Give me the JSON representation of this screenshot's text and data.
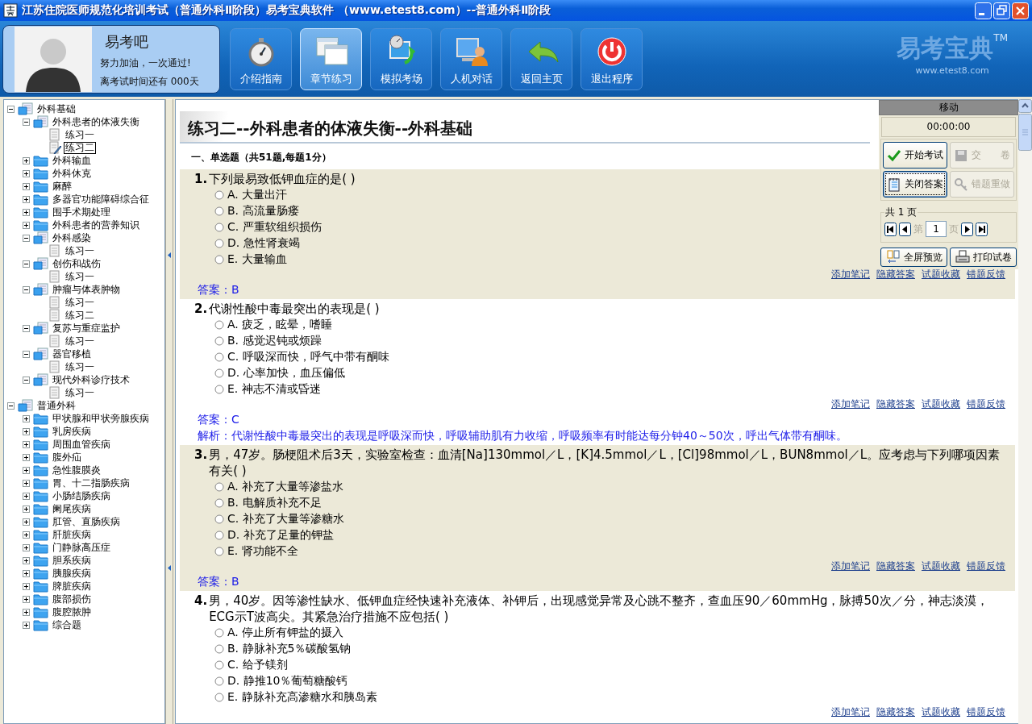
{
  "window": {
    "title": "江苏住院医师规范化培训考试（普通外科Ⅱ阶段）易考宝典软件  （www.etest8.com）--普通外科Ⅱ阶段"
  },
  "profile": {
    "name": "易考吧",
    "slogan": "努力加油，一次通过!",
    "countdown": "离考试时间还有 000天"
  },
  "toolbar": [
    {
      "label": "介绍指南",
      "selected": false
    },
    {
      "label": "章节练习",
      "selected": true
    },
    {
      "label": "模拟考场",
      "selected": false
    },
    {
      "label": "人机对话",
      "selected": false
    },
    {
      "label": "返回主页",
      "selected": false
    },
    {
      "label": "退出程序",
      "selected": false
    }
  ],
  "logo": {
    "name": "易考宝典",
    "mark": "TM",
    "url": "www.etest8.com"
  },
  "tree": [
    {
      "label": "外科基础",
      "kind": "folder",
      "expanded": true,
      "children": [
        {
          "label": "外科患者的体液失衡",
          "kind": "folder",
          "expanded": true,
          "children": [
            {
              "label": "练习一",
              "kind": "exercise",
              "selected": false
            },
            {
              "label": "练习二",
              "kind": "exercise",
              "selected": true
            }
          ]
        },
        {
          "label": "外科输血",
          "kind": "folder",
          "expanded": false
        },
        {
          "label": "外科休克",
          "kind": "folder",
          "expanded": false
        },
        {
          "label": "麻醉",
          "kind": "folder",
          "expanded": false
        },
        {
          "label": "多器官功能障碍综合征",
          "kind": "folder",
          "expanded": false
        },
        {
          "label": "围手术期处理",
          "kind": "folder",
          "expanded": false
        },
        {
          "label": "外科患者的营养知识",
          "kind": "folder",
          "expanded": false
        },
        {
          "label": "外科感染",
          "kind": "folder",
          "expanded": true,
          "children": [
            {
              "label": "练习一",
              "kind": "exercise",
              "selected": false
            }
          ]
        },
        {
          "label": "创伤和战伤",
          "kind": "folder",
          "expanded": true,
          "children": [
            {
              "label": "练习一",
              "kind": "exercise",
              "selected": false
            }
          ]
        },
        {
          "label": "肿瘤与体表肿物",
          "kind": "folder",
          "expanded": true,
          "children": [
            {
              "label": "练习一",
              "kind": "exercise",
              "selected": false
            },
            {
              "label": "练习二",
              "kind": "exercise",
              "selected": false
            }
          ]
        },
        {
          "label": "复苏与重症监护",
          "kind": "folder",
          "expanded": true,
          "children": [
            {
              "label": "练习一",
              "kind": "exercise",
              "selected": false
            }
          ]
        },
        {
          "label": "器官移植",
          "kind": "folder",
          "expanded": true,
          "children": [
            {
              "label": "练习一",
              "kind": "exercise",
              "selected": false
            }
          ]
        },
        {
          "label": "现代外科诊疗技术",
          "kind": "folder",
          "expanded": true,
          "children": [
            {
              "label": "练习一",
              "kind": "exercise",
              "selected": false
            }
          ]
        }
      ]
    },
    {
      "label": "普通外科",
      "kind": "folder",
      "expanded": true,
      "children": [
        {
          "label": "甲状腺和甲状旁腺疾病",
          "kind": "folder",
          "expanded": false
        },
        {
          "label": "乳房疾病",
          "kind": "folder",
          "expanded": false
        },
        {
          "label": "周围血管疾病",
          "kind": "folder",
          "expanded": false
        },
        {
          "label": "腹外疝",
          "kind": "folder",
          "expanded": false
        },
        {
          "label": "急性腹膜炎",
          "kind": "folder",
          "expanded": false
        },
        {
          "label": "胃、十二指肠疾病",
          "kind": "folder",
          "expanded": false
        },
        {
          "label": "小肠结肠疾病",
          "kind": "folder",
          "expanded": false
        },
        {
          "label": "阑尾疾病",
          "kind": "folder",
          "expanded": false
        },
        {
          "label": "肛管、直肠疾病",
          "kind": "folder",
          "expanded": false
        },
        {
          "label": "肝脏疾病",
          "kind": "folder",
          "expanded": false
        },
        {
          "label": "门静脉高压症",
          "kind": "folder",
          "expanded": false
        },
        {
          "label": "胆系疾病",
          "kind": "folder",
          "expanded": false
        },
        {
          "label": "胰腺疾病",
          "kind": "folder",
          "expanded": false
        },
        {
          "label": "脾脏疾病",
          "kind": "folder",
          "expanded": false
        },
        {
          "label": "腹部损伤",
          "kind": "folder",
          "expanded": false
        },
        {
          "label": "腹腔脓肿",
          "kind": "folder",
          "expanded": false
        },
        {
          "label": "综合题",
          "kind": "folder",
          "expanded": false
        }
      ]
    }
  ],
  "content": {
    "title": "练习二--外科患者的体液失衡--外科基础",
    "section": "一、单选题（共51题,每题1分）",
    "questions": [
      {
        "number": "1.",
        "text": "下列最易致低钾血症的是( )",
        "highlighted": true,
        "options": [
          {
            "text": "A. 大量出汗",
            "selected": false
          },
          {
            "text": "B. 高流量肠瘘",
            "selected": false
          },
          {
            "text": "C. 严重软组织损伤",
            "selected": false
          },
          {
            "text": "D. 急性肾衰竭",
            "selected": false
          },
          {
            "text": "E. 大量输血",
            "selected": false
          }
        ],
        "links": [
          "添加笔记",
          "隐藏答案",
          "试题收藏",
          "错题反馈"
        ],
        "answer": "答案：B"
      },
      {
        "number": "2.",
        "text": "代谢性酸中毒最突出的表现是( )",
        "highlighted": false,
        "options": [
          {
            "text": "A. 疲乏，眩晕，嗜睡",
            "selected": false
          },
          {
            "text": "B. 感觉迟钝或烦躁",
            "selected": false
          },
          {
            "text": "C. 呼吸深而快，呼气中带有酮味",
            "selected": false
          },
          {
            "text": "D. 心率加快，血压偏低",
            "selected": false
          },
          {
            "text": "E. 神志不清或昏迷",
            "selected": false
          }
        ],
        "links": [
          "添加笔记",
          "隐藏答案",
          "试题收藏",
          "错题反馈"
        ],
        "answer": "答案：C",
        "explanation": "解析：代谢性酸中毒最突出的表现是呼吸深而快，呼吸辅助肌有力收缩，呼吸频率有时能达每分钟40～50次，呼出气体带有酮味。"
      },
      {
        "number": "3.",
        "text": "男，47岁。肠梗阻术后3天，实验室检查：血清[Na]130mmol／L，[K]4.5mmol／L，[Cl]98mmol／L，BUN8mmol／L。应考虑与下列哪项因素有关( )",
        "highlighted": true,
        "options": [
          {
            "text": "A. 补充了大量等渗盐水",
            "selected": false
          },
          {
            "text": "B. 电解质补充不足",
            "selected": false
          },
          {
            "text": "C. 补充了大量等渗糖水",
            "selected": false
          },
          {
            "text": "D. 补充了足量的钾盐",
            "selected": false
          },
          {
            "text": "E. 肾功能不全",
            "selected": false
          }
        ],
        "links": [
          "添加笔记",
          "隐藏答案",
          "试题收藏",
          "错题反馈"
        ],
        "answer": "答案：B"
      },
      {
        "number": "4.",
        "text": "男，40岁。因等渗性缺水、低钾血症经快速补充液体、补钾后，出现感觉异常及心跳不整齐，查血压90／60mmHg，脉搏50次／分，神志淡漠，ECG示T波高尖。其紧急治疗措施不应包括( )",
        "highlighted": false,
        "options": [
          {
            "text": "A. 停止所有钾盐的摄入",
            "selected": false
          },
          {
            "text": "B. 静脉补充5％碳酸氢钠",
            "selected": false
          },
          {
            "text": "C. 给予镁剂",
            "selected": false
          },
          {
            "text": "D. 静推10％葡萄糖酸钙",
            "selected": false
          },
          {
            "text": "E. 静脉补充高渗糖水和胰岛素",
            "selected": false
          }
        ],
        "links": [
          "添加笔记",
          "隐藏答案",
          "试题收藏",
          "错题反馈"
        ]
      }
    ]
  },
  "side_panel": {
    "handle": "移动",
    "timer": "00:00:00",
    "buttons": [
      {
        "label": "开始考试",
        "disabled": false,
        "focused": false
      },
      {
        "label": "交　　卷",
        "disabled": true,
        "focused": false
      },
      {
        "label": "关闭答案",
        "disabled": false,
        "focused": true
      },
      {
        "label": "错题重做",
        "disabled": true,
        "focused": false
      }
    ],
    "pager": {
      "legend": "共 1 页",
      "prefix": "第",
      "page": "1",
      "suffix": "页"
    },
    "bottom_buttons": [
      {
        "label": "全屏预览"
      },
      {
        "label": "打印试卷"
      }
    ]
  }
}
